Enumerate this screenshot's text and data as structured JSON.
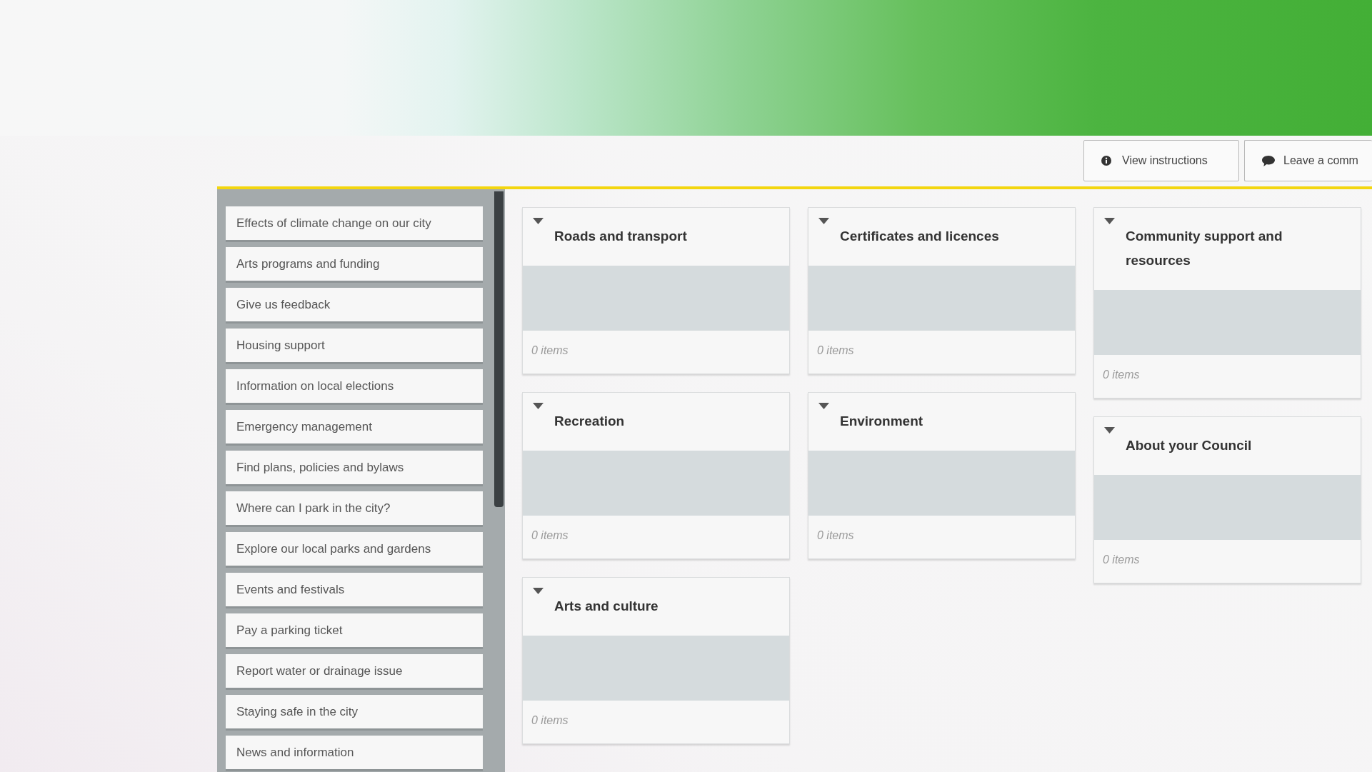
{
  "toolbar": {
    "buttons": [
      {
        "kind": "info",
        "label": "View instructions"
      },
      {
        "kind": "comment",
        "label": "Leave a comm"
      }
    ]
  },
  "sidebar": {
    "items": [
      "Effects of climate change on our city",
      "Arts programs and funding",
      "Give us feedback",
      "Housing support",
      "Information on local elections",
      "Emergency management",
      "Find plans, policies and bylaws",
      "Where can I park in the city?",
      "Explore our local parks and gardens",
      "Events and festivals",
      "Pay a parking ticket",
      "Report water or drainage issue",
      "Staying safe in the city",
      "News and information"
    ]
  },
  "board": {
    "columns": [
      {
        "cards": [
          {
            "title": "Roads and transport",
            "expanded": true,
            "count": "0 items"
          },
          {
            "title": "Recreation",
            "expanded": true,
            "count": "0 items"
          },
          {
            "title": "Arts and culture",
            "expanded": true,
            "count": "0 items"
          }
        ]
      },
      {
        "cards": [
          {
            "title": "Certificates and licences",
            "expanded": true,
            "count": "0 items"
          },
          {
            "title": "Environment",
            "expanded": true,
            "count": "0 items"
          }
        ]
      },
      {
        "cards": [
          {
            "title": "Community support and resources",
            "expanded": true,
            "count": "0 items"
          },
          {
            "title": "About your Council",
            "expanded": true,
            "count": "0 items"
          }
        ]
      }
    ]
  }
}
